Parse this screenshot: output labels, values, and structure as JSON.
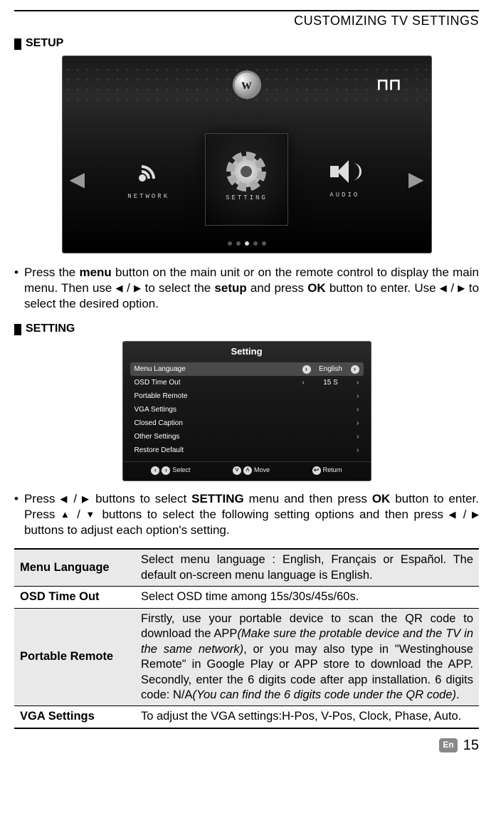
{
  "header": {
    "title": "CUSTOMIZING TV SETTINGS"
  },
  "section1": {
    "title": "SETUP"
  },
  "tv": {
    "logo_letter": "w",
    "signal": "⊓⊓",
    "panels": {
      "left": "NETWORK",
      "center": "SETTING",
      "right": "AUDIO"
    }
  },
  "instruction1": {
    "bullet": "•",
    "p1a": "Press the ",
    "p1b": "menu",
    "p1c": " button on the main unit or on the remote control to display the main menu. Then use ",
    "p1d": " to select the ",
    "p1e": "setup",
    "p1f": " and press ",
    "p1g": "OK",
    "p1h": " button to enter. Use ",
    "p1i": " to select the desired option."
  },
  "section2": {
    "title": "SETTING"
  },
  "setting_menu": {
    "title": "Setting",
    "rows": [
      {
        "label": "Menu Language",
        "value": "English",
        "selected": true,
        "arrows": "circle"
      },
      {
        "label": "OSD Time Out",
        "value": "15 S",
        "arrows": "plain"
      },
      {
        "label": "Portable Remote",
        "value": "",
        "chevron": true
      },
      {
        "label": "VGA Settings",
        "value": "",
        "chevron": true
      },
      {
        "label": "Closed Caption",
        "value": "",
        "chevron": true
      },
      {
        "label": "Other Settings",
        "value": "",
        "chevron": true
      },
      {
        "label": "Restore Default",
        "value": "",
        "chevron": true
      }
    ],
    "footer": {
      "select": "Select",
      "move": "Move",
      "return": "Return"
    }
  },
  "instruction2": {
    "bullet": "•",
    "p2a": "Press ",
    "p2b": " buttons to select ",
    "p2c": "SETTING",
    "p2d": " menu and then press ",
    "p2e": "OK",
    "p2f": " button to enter. Press ",
    "p2g": " buttons to select the following setting options and then press ",
    "p2h": " buttons to adjust each option's setting."
  },
  "table": {
    "rows": [
      {
        "name": "Menu Language",
        "desc": "Select menu language : English, Français or Español. The default on-screen menu language is English."
      },
      {
        "name": "OSD Time Out",
        "desc": "Select OSD time among 15s/30s/45s/60s."
      },
      {
        "name": "Portable Remote",
        "desc_a": "Firstly, use your portable device to scan the QR code to download the APP",
        "desc_b": "(Make sure the protable device and the TV in the same network)",
        "desc_c": ", or you may also type in \"Westinghouse Remote\" in Google Play or APP store to download the APP. Secondly, enter the 6 digits code after app installation. 6 digits code: N/A",
        "desc_d": "(You can find the 6 digits code under the QR code)",
        "desc_e": "."
      },
      {
        "name": "VGA Settings",
        "desc": "To adjust the VGA settings:H-Pos, V-Pos, Clock, Phase, Auto."
      }
    ]
  },
  "footer": {
    "lang": "En",
    "page": "15"
  },
  "glyphs": {
    "left": "◀",
    "right": "▶",
    "up": "▲",
    "down": "▼",
    "slash": " / "
  }
}
